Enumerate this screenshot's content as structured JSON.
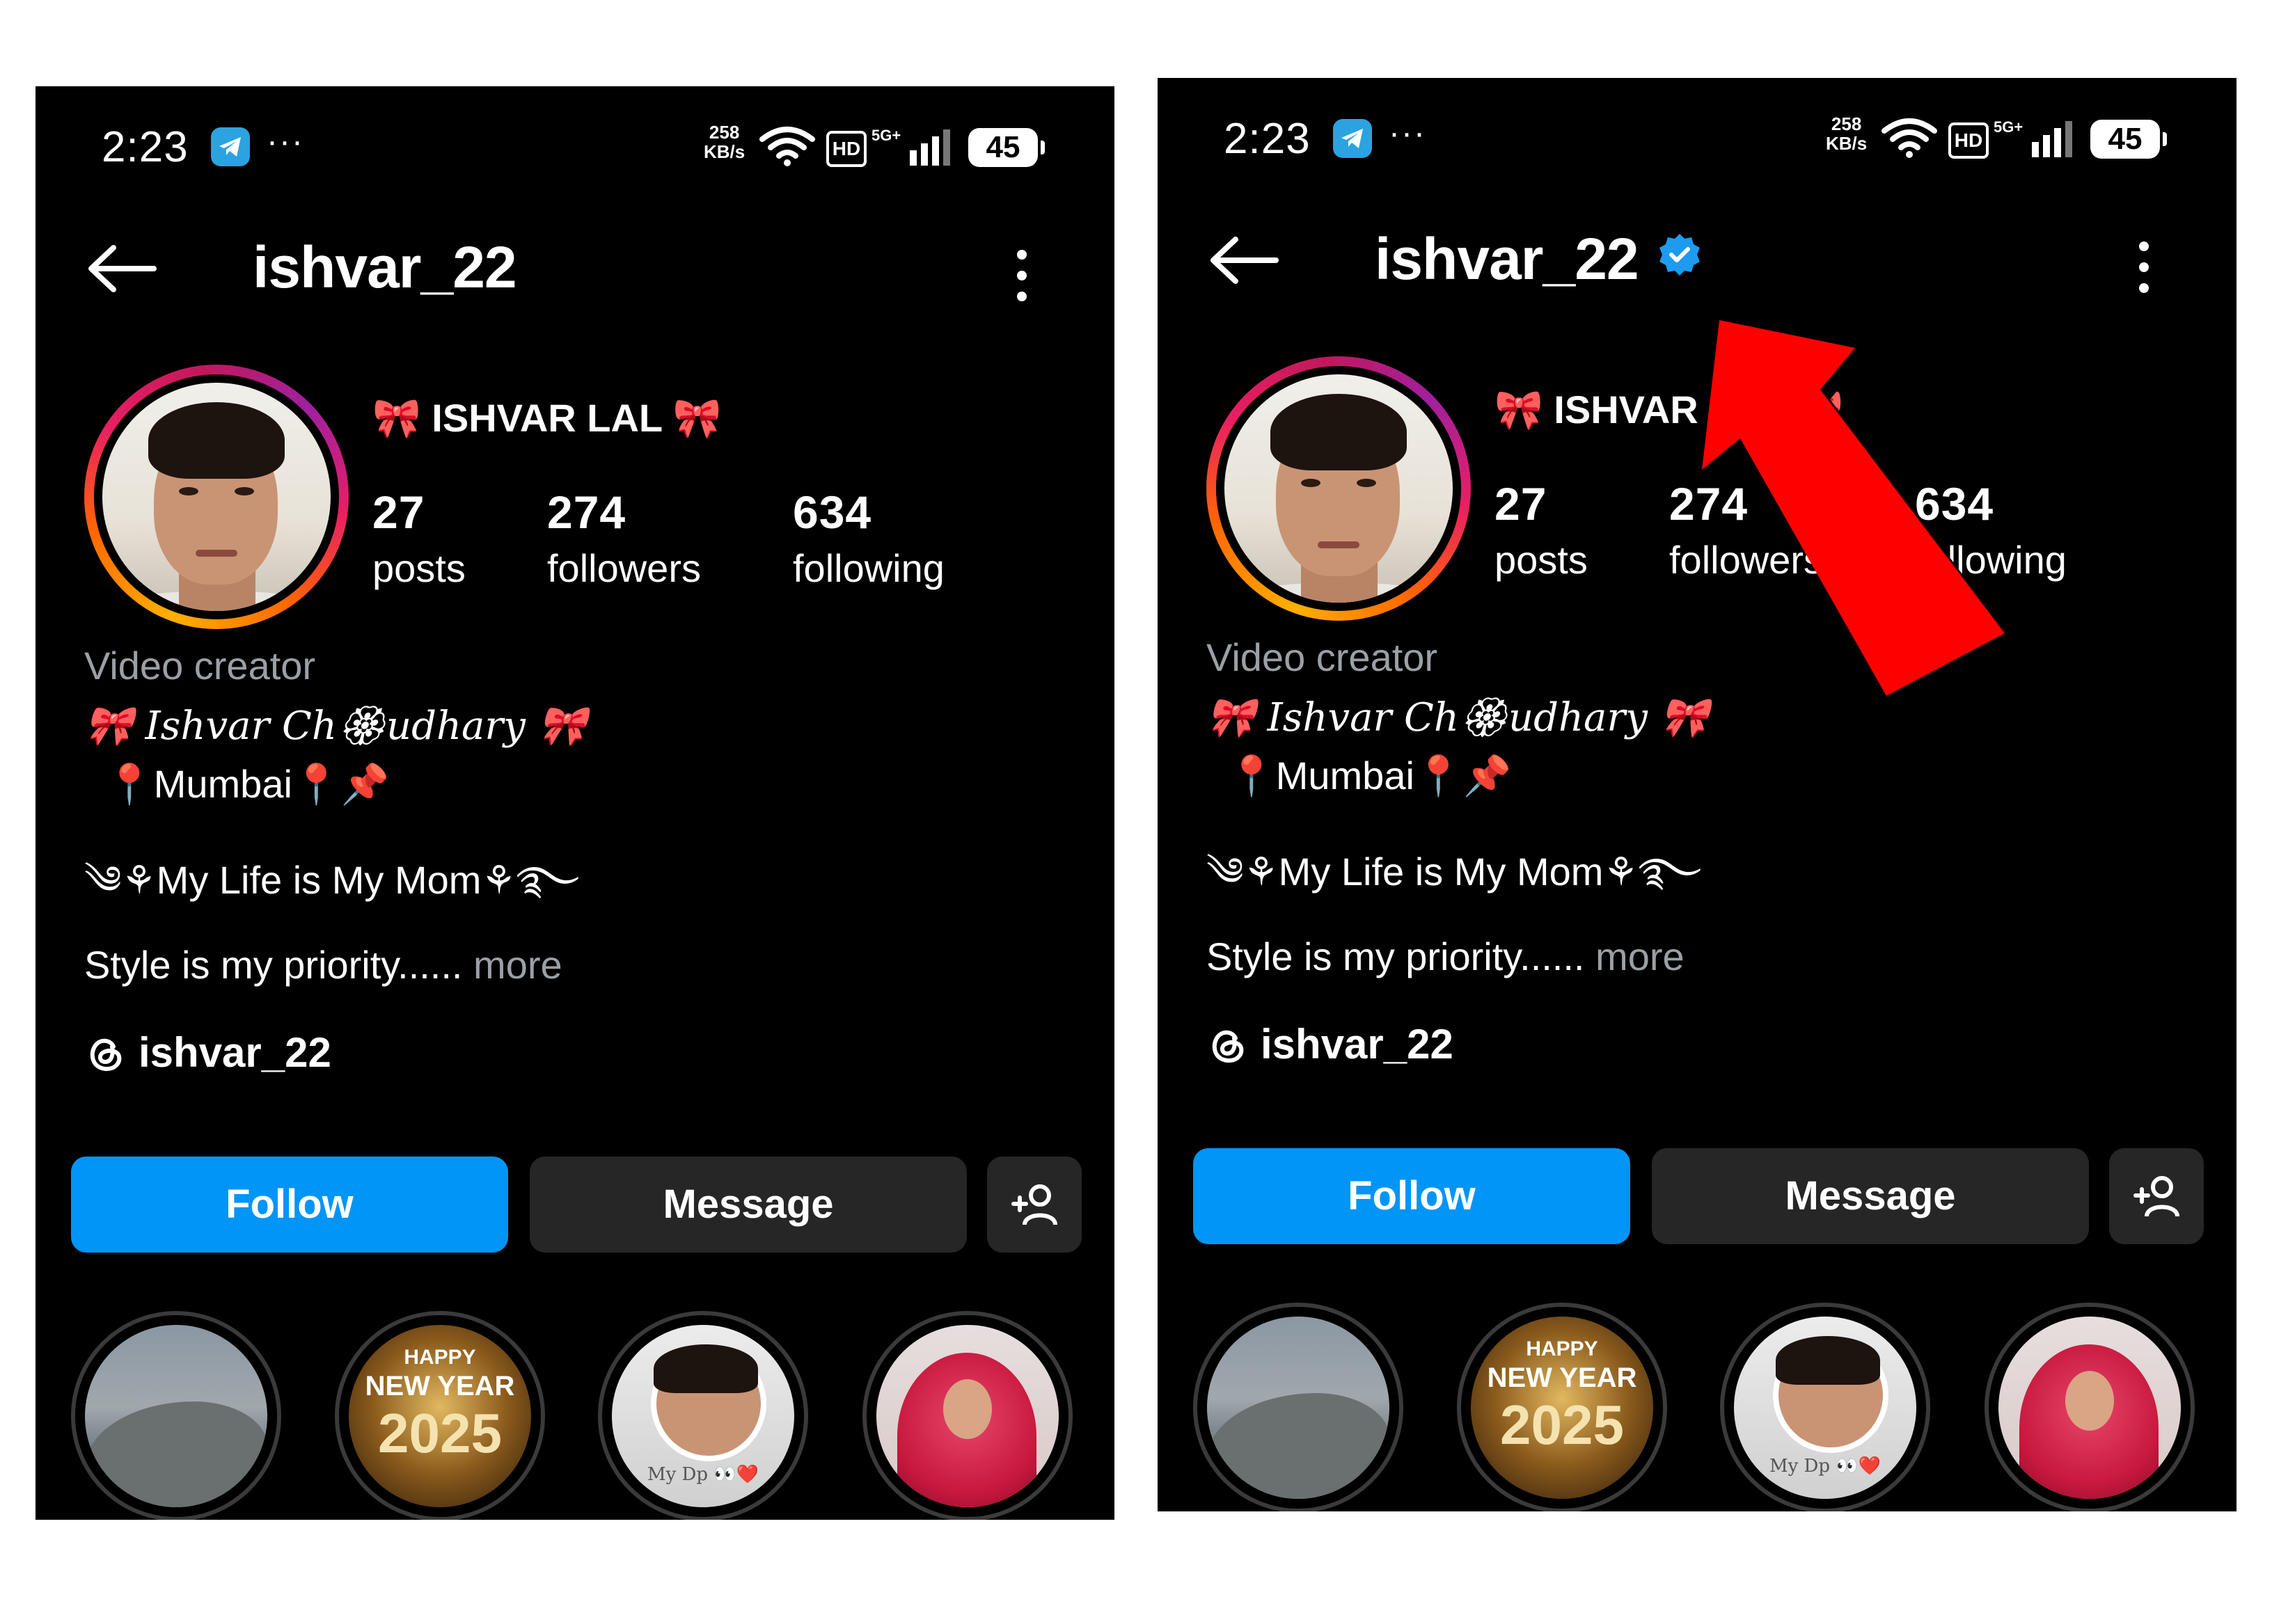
{
  "status": {
    "time": "2:23",
    "network_speed_value": "258",
    "network_speed_unit": "KB/s",
    "hd_label": "HD",
    "signal_label": "5G+",
    "battery": "45",
    "more_dots": "···"
  },
  "profile": {
    "username": "ishvar_22",
    "full_name": "🎀 ISHVAR LAL 🎀",
    "posts_count": "27",
    "posts_label": "posts",
    "followers_count": "274",
    "followers_label": "followers",
    "following_count": "634",
    "following_label": "following",
    "category": "Video creator",
    "bio_line_1": "🎀 Ishvar Ch🏵udhary 🎀",
    "bio_line_2": "📍Mumbai📍📌",
    "bio_line_3": "༄⚘My Life is My Mom⚘࿐",
    "bio_line_4": "Style is my priority......",
    "more_label": "more",
    "threads_handle": "ishvar_22"
  },
  "actions": {
    "follow_label": "Follow",
    "message_label": "Message"
  },
  "highlights": {
    "ny_happy": "HAPPY",
    "ny_new_year": "NEW YEAR",
    "ny_year": "2025",
    "dp_label": "My Dp 👀❤️"
  },
  "colors": {
    "background": "#000000",
    "follow_button": "#0095f6",
    "secondary_button": "#262626",
    "muted_text": "#9aa0a6",
    "verified_badge": "#1d9bf0",
    "annotation_arrow": "#ff0000"
  },
  "icons": {
    "back": "back-arrow-icon",
    "menu": "more-vertical-icon",
    "add_user": "add-user-icon",
    "threads": "threads-icon",
    "verified": "verified-badge-icon",
    "telegram": "telegram-icon",
    "wifi": "wifi-icon",
    "signal": "signal-icon"
  }
}
